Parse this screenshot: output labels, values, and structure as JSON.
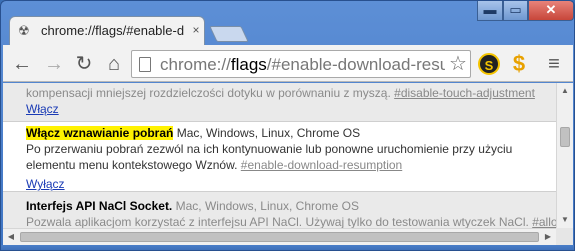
{
  "tab": {
    "icon": "radiation-icon",
    "title": "chrome://flags/#enable-d",
    "close": "×"
  },
  "window_controls": {
    "minimize": "▬",
    "maximize": "▭",
    "close": "✕"
  },
  "toolbar": {
    "back": "←",
    "forward": "→",
    "reload": "↻",
    "home": "⌂",
    "star": "☆",
    "ext1": "S",
    "ext2": "$",
    "menu": "≡"
  },
  "omnibox": {
    "scheme": "chrome://",
    "host": "flags",
    "rest": "/#enable-download-resum"
  },
  "experiments": [
    {
      "description": "kompensacji mniejszej rozdzielczości dotyku w porównaniu z myszą.",
      "anchor": "#disable-touch-adjustment",
      "action": "Włącz"
    },
    {
      "name": "Włącz wznawianie pobrań",
      "platforms": "Mac, Windows, Linux, Chrome OS",
      "description": "Po przerwaniu pobrań zezwól na ich kontynuowanie lub ponowne uruchomienie przy użyciu elementu menu kontekstowego Wznów.",
      "anchor": "#enable-download-resumption",
      "action": "Wyłącz"
    },
    {
      "name": "Interfejs API NaCl Socket.",
      "platforms": "Mac, Windows, Linux, Chrome OS",
      "description": "Pozwala aplikacjom korzystać z interfejsu API NaCl. Używaj tylko do testowania wtyczek NaCl.",
      "anchor": "#allow-nacl-socket"
    }
  ],
  "scrollbars": {
    "up": "▲",
    "down": "▼",
    "left": "◀",
    "right": "▶"
  }
}
